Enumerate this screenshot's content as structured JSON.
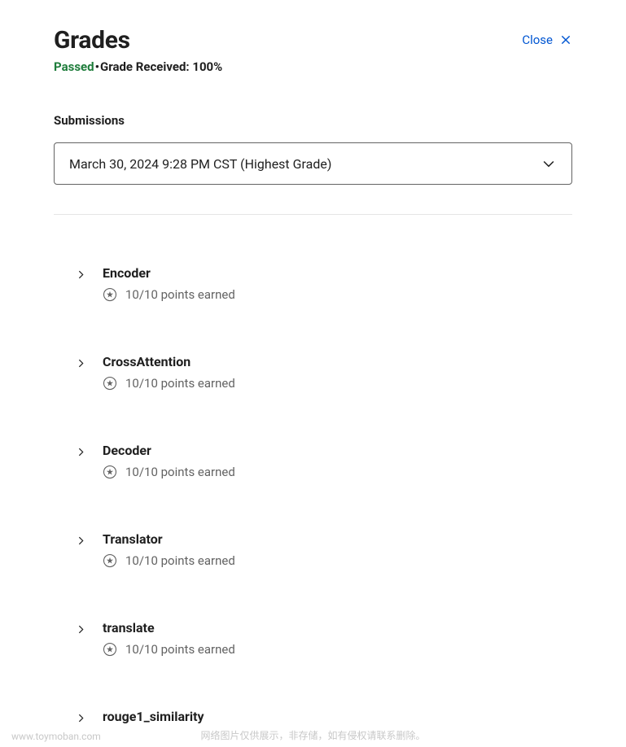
{
  "header": {
    "title": "Grades",
    "close_label": "Close"
  },
  "status": {
    "passed_label": "Passed",
    "separator": "•",
    "grade_label": "Grade Received: 100%"
  },
  "submissions": {
    "label": "Submissions",
    "selected": "March 30, 2024 9:28 PM CST (Highest Grade)"
  },
  "items": [
    {
      "title": "Encoder",
      "points": "10/10 points earned"
    },
    {
      "title": "CrossAttention",
      "points": "10/10 points earned"
    },
    {
      "title": "Decoder",
      "points": "10/10 points earned"
    },
    {
      "title": "Translator",
      "points": "10/10 points earned"
    },
    {
      "title": "translate",
      "points": "10/10 points earned"
    },
    {
      "title": "rouge1_similarity",
      "points": ""
    }
  ],
  "watermark": {
    "left": "www.toymoban.com",
    "center": "网络图片仅供展示，非存储，如有侵权请联系删除。"
  }
}
